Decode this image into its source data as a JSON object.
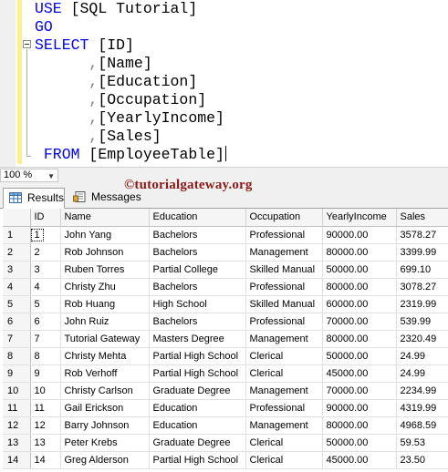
{
  "editor": {
    "lines": [
      {
        "parts": [
          {
            "t": "USE ",
            "c": "kw"
          },
          {
            "t": "[SQL Tutorial]",
            "c": "plain"
          }
        ]
      },
      {
        "parts": [
          {
            "t": "GO",
            "c": "kw"
          }
        ]
      },
      {
        "parts": [
          {
            "t": "SELECT ",
            "c": "kw"
          },
          {
            "t": "[ID]",
            "c": "plain"
          }
        ]
      },
      {
        "parts": [
          {
            "t": "      ,",
            "c": "gray"
          },
          {
            "t": "[Name]",
            "c": "plain"
          }
        ]
      },
      {
        "parts": [
          {
            "t": "      ,",
            "c": "gray"
          },
          {
            "t": "[Education]",
            "c": "plain"
          }
        ]
      },
      {
        "parts": [
          {
            "t": "      ,",
            "c": "gray"
          },
          {
            "t": "[Occupation]",
            "c": "plain"
          }
        ]
      },
      {
        "parts": [
          {
            "t": "      ,",
            "c": "gray"
          },
          {
            "t": "[YearlyIncome]",
            "c": "plain"
          }
        ]
      },
      {
        "parts": [
          {
            "t": "      ,",
            "c": "gray"
          },
          {
            "t": "[Sales]",
            "c": "plain"
          }
        ]
      },
      {
        "parts": [
          {
            "t": " FROM ",
            "c": "kw"
          },
          {
            "t": "[EmployeeTable]",
            "c": "plain"
          }
        ],
        "caret": true
      }
    ]
  },
  "zoom": {
    "value": "100 %"
  },
  "watermark": "©tutorialgateway.org",
  "tabs": [
    {
      "label": "Results",
      "icon": "grid-icon",
      "active": true
    },
    {
      "label": "Messages",
      "icon": "messages-icon",
      "active": false
    }
  ],
  "grid": {
    "columns": [
      "ID",
      "Name",
      "Education",
      "Occupation",
      "YearlyIncome",
      "Sales"
    ],
    "rows": [
      [
        "1",
        "1",
        "John Yang",
        "Bachelors",
        "Professional",
        "90000.00",
        "3578.27"
      ],
      [
        "2",
        "2",
        "Rob Johnson",
        "Bachelors",
        "Management",
        "80000.00",
        "3399.99"
      ],
      [
        "3",
        "3",
        "Ruben Torres",
        "Partial College",
        "Skilled Manual",
        "50000.00",
        "699.10"
      ],
      [
        "4",
        "4",
        "Christy Zhu",
        "Bachelors",
        "Professional",
        "80000.00",
        "3078.27"
      ],
      [
        "5",
        "5",
        "Rob Huang",
        "High School",
        "Skilled Manual",
        "60000.00",
        "2319.99"
      ],
      [
        "6",
        "6",
        "John Ruiz",
        "Bachelors",
        "Professional",
        "70000.00",
        "539.99"
      ],
      [
        "7",
        "7",
        "Tutorial Gateway",
        "Masters Degree",
        "Management",
        "80000.00",
        "2320.49"
      ],
      [
        "8",
        "8",
        "Christy Mehta",
        "Partial High School",
        "Clerical",
        "50000.00",
        "24.99"
      ],
      [
        "9",
        "9",
        "Rob Verhoff",
        "Partial High School",
        "Clerical",
        "45000.00",
        "24.99"
      ],
      [
        "10",
        "10",
        "Christy Carlson",
        "Graduate Degree",
        "Management",
        "70000.00",
        "2234.99"
      ],
      [
        "11",
        "11",
        "Gail Erickson",
        "Education",
        "Professional",
        "90000.00",
        "4319.99"
      ],
      [
        "12",
        "12",
        "Barry Johnson",
        "Education",
        "Management",
        "80000.00",
        "4968.59"
      ],
      [
        "13",
        "13",
        "Peter Krebs",
        "Graduate Degree",
        "Clerical",
        "50000.00",
        "59.53"
      ],
      [
        "14",
        "14",
        "Greg Alderson",
        "Partial High School",
        "Clerical",
        "45000.00",
        "23.50"
      ]
    ]
  }
}
